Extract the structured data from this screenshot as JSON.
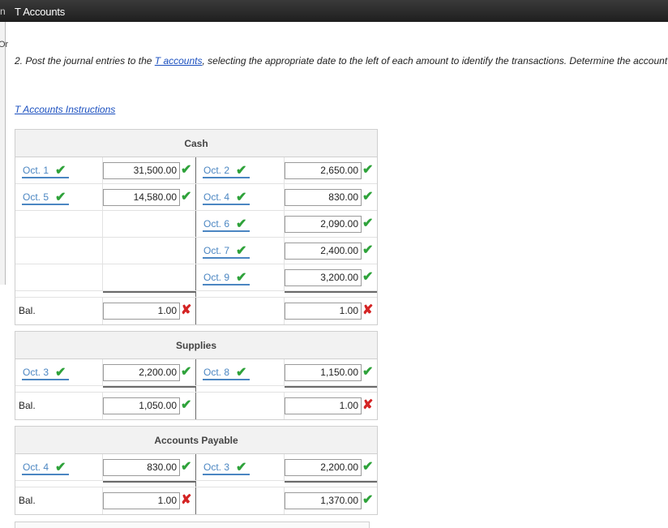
{
  "window": {
    "title": "T Accounts",
    "edge_char": "n",
    "left_edge_char": "Or"
  },
  "instructions": {
    "text_before": "2. Post the journal entries to the ",
    "link_text": "T accounts",
    "text_after": ", selecting the appropriate date to the left of each amount to identify the transactions. Determine the account"
  },
  "instructions_link": "T Accounts Instructions",
  "accounts": [
    {
      "title": "Cash",
      "rows": [
        {
          "left_date": "Oct. 1",
          "left_amount": "31,500.00",
          "right_date": "Oct. 2",
          "right_amount": "2,650.00"
        },
        {
          "left_date": "Oct. 5",
          "left_amount": "14,580.00",
          "right_date": "Oct. 4",
          "right_amount": "830.00"
        },
        {
          "left_date": "",
          "left_amount": "",
          "right_date": "Oct. 6",
          "right_amount": "2,090.00"
        },
        {
          "left_date": "",
          "left_amount": "",
          "right_date": "Oct. 7",
          "right_amount": "2,400.00"
        },
        {
          "left_date": "",
          "left_amount": "",
          "right_date": "Oct. 9",
          "right_amount": "3,200.00"
        }
      ],
      "balance": {
        "label": "Bal.",
        "left_amount": "1.00",
        "left_status": "incorrect",
        "right_amount": "1.00",
        "right_status": "incorrect"
      }
    },
    {
      "title": "Supplies",
      "rows": [
        {
          "left_date": "Oct. 3",
          "left_amount": "2,200.00",
          "right_date": "Oct. 8",
          "right_amount": "1,150.00"
        }
      ],
      "balance": {
        "label": "Bal.",
        "left_amount": "1,050.00",
        "left_status": "correct",
        "right_amount": "1.00",
        "right_status": "incorrect"
      }
    },
    {
      "title": "Accounts Payable",
      "rows": [
        {
          "left_date": "Oct. 4",
          "left_amount": "830.00",
          "right_date": "Oct. 3",
          "right_amount": "2,200.00"
        }
      ],
      "balance": {
        "label": "Bal.",
        "left_amount": "1.00",
        "left_status": "incorrect",
        "right_amount": "1,370.00",
        "right_status": "correct"
      }
    }
  ],
  "marks": {
    "correct": "✔",
    "incorrect": "✘"
  },
  "colors": {
    "correct": "#2ea23a",
    "incorrect": "#d42424",
    "link": "#1a4fbf",
    "date_underline": "#4b86c2"
  }
}
